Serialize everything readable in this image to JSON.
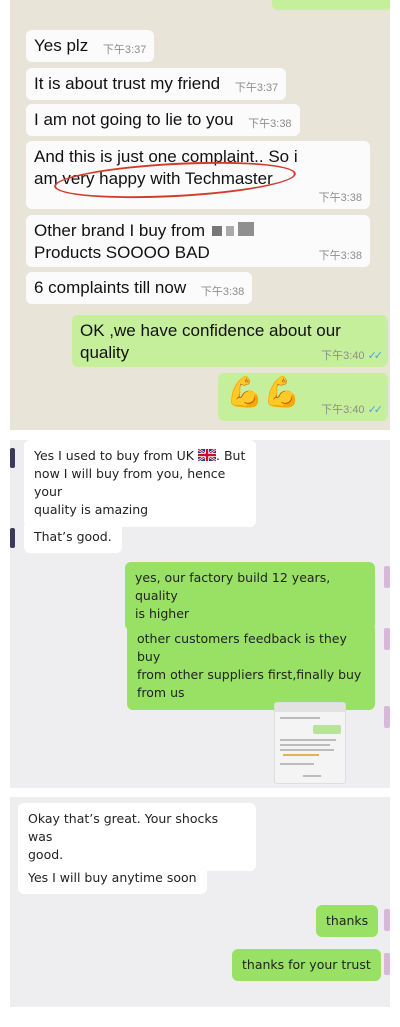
{
  "panel1": {
    "messages": [
      {
        "id": "m1",
        "dir": "in",
        "text": "Yes plz",
        "time": "下午3:37"
      },
      {
        "id": "m2",
        "dir": "in",
        "text": "It is about trust my friend",
        "time": "下午3:37"
      },
      {
        "id": "m3",
        "dir": "in",
        "text": "I am not going to lie to you",
        "time": "下午3:38"
      },
      {
        "id": "m4",
        "dir": "in",
        "line1": "And this is just one complaint.. So i",
        "line2": "am very happy with Techmaster",
        "time": "下午3:38"
      },
      {
        "id": "m5",
        "dir": "in",
        "line1": "Other brand I buy from",
        "line2": "Products SOOOO BAD",
        "time": "下午3:38"
      },
      {
        "id": "m6",
        "dir": "in",
        "text": "6 complaints till now",
        "time": "下午3:38"
      },
      {
        "id": "m7",
        "dir": "out",
        "line1": "OK ,we have confidence about our",
        "line2": "quality",
        "time": "下午3:40"
      },
      {
        "id": "m8",
        "dir": "out",
        "emoji": "💪💪",
        "time": "下午3:40"
      }
    ],
    "colors": {
      "background": "#e8e4d8",
      "incoming": "#fbfbfb",
      "outgoing": "#c6ef9c",
      "highlight_circle": "#d23b2a",
      "read_ticks": "#4aa3e0"
    },
    "icons": [
      "read-receipt-icon",
      "muscle-emoji-icon"
    ]
  },
  "panel2": {
    "messages": [
      {
        "id": "w1",
        "dir": "in",
        "line1": "Yes I used to buy from UK",
        "line1b": ". But",
        "line2": "now I will buy from you, hence your",
        "line3": "quality is amazing"
      },
      {
        "id": "w2",
        "dir": "in",
        "text": "That’s good."
      },
      {
        "id": "w3",
        "dir": "out",
        "line1": "yes, our factory build 12 years, quality",
        "line2": "is higher"
      },
      {
        "id": "w4",
        "dir": "out",
        "line1": "other customers feedback is they buy",
        "line2": "from other suppliers first,finally buy",
        "line3": "from us"
      }
    ],
    "icons": [
      "uk-flag-icon",
      "screenshot-thumbnail"
    ]
  },
  "panel3": {
    "messages": [
      {
        "id": "x1",
        "dir": "in",
        "line1": "Okay that’s great. Your shocks was",
        "line2": "good."
      },
      {
        "id": "x2",
        "dir": "in",
        "text": "Yes I will buy anytime soon"
      },
      {
        "id": "x3",
        "dir": "out",
        "text": "thanks"
      },
      {
        "id": "x4",
        "dir": "out",
        "text": "thanks for your trust"
      }
    ],
    "colors": {
      "background": "#eeeef0",
      "incoming": "#ffffff",
      "outgoing": "#98e165"
    }
  }
}
